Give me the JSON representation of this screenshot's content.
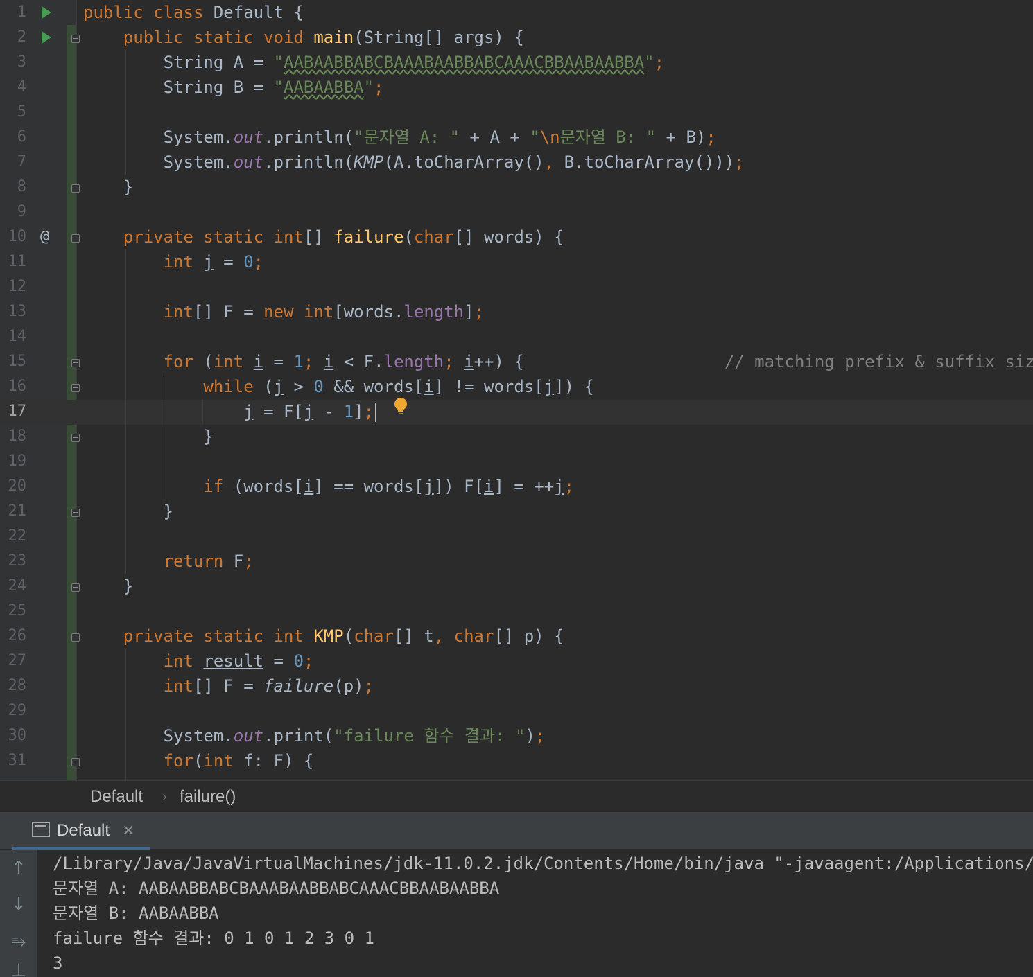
{
  "editor": {
    "current_line": 17,
    "lines": [
      {
        "n": "1",
        "tokens": [
          [
            "public class ",
            "kw"
          ],
          [
            "Default {",
            ""
          ]
        ]
      },
      {
        "n": "2",
        "tokens": [
          [
            "    public static void ",
            "kw"
          ],
          [
            "main",
            "fn"
          ],
          [
            "(String[] args) {",
            ""
          ]
        ]
      },
      {
        "n": "3",
        "tokens": [
          [
            "        String A = ",
            ""
          ],
          [
            "\"",
            "str"
          ],
          [
            "AABAABBABCBAAABAABBABCAAACBBAABAABBA",
            "str wavy"
          ],
          [
            "\"",
            "str"
          ],
          [
            ";",
            "kw"
          ]
        ]
      },
      {
        "n": "4",
        "tokens": [
          [
            "        String B = ",
            ""
          ],
          [
            "\"",
            "str"
          ],
          [
            "AABAABBA",
            "str wavy"
          ],
          [
            "\"",
            "str"
          ],
          [
            ";",
            "kw"
          ]
        ]
      },
      {
        "n": "5",
        "tokens": []
      },
      {
        "n": "6",
        "tokens": [
          [
            "        System.",
            ""
          ],
          [
            "out",
            "fld"
          ],
          [
            ".println(",
            ""
          ],
          [
            "\"문자열 A: \"",
            "str"
          ],
          [
            " + A + ",
            ""
          ],
          [
            "\"",
            "str"
          ],
          [
            "\\n",
            "kw"
          ],
          [
            "문자열 B: \"",
            "str"
          ],
          [
            " + B)",
            ""
          ],
          [
            ";",
            "kw"
          ]
        ]
      },
      {
        "n": "7",
        "tokens": [
          [
            "        System.",
            ""
          ],
          [
            "out",
            "fld"
          ],
          [
            ".println(",
            ""
          ],
          [
            "KMP",
            "ital"
          ],
          [
            "(A.toCharArray()",
            ""
          ],
          [
            ", ",
            "kw"
          ],
          [
            "B.toCharArray()))",
            ""
          ],
          [
            ";",
            "kw"
          ]
        ]
      },
      {
        "n": "8",
        "tokens": [
          [
            "    }",
            ""
          ]
        ]
      },
      {
        "n": "9",
        "tokens": []
      },
      {
        "n": "10",
        "tokens": [
          [
            "    private static int",
            "kw"
          ],
          [
            "[] ",
            ""
          ],
          [
            "failure",
            "fn"
          ],
          [
            "(",
            ""
          ],
          [
            "char",
            "kw"
          ],
          [
            "[] words) {",
            ""
          ]
        ]
      },
      {
        "n": "11",
        "tokens": [
          [
            "        int ",
            "kw"
          ],
          [
            "j",
            "ul"
          ],
          [
            " = ",
            ""
          ],
          [
            "0",
            "num"
          ],
          [
            ";",
            "kw"
          ]
        ]
      },
      {
        "n": "12",
        "tokens": []
      },
      {
        "n": "13",
        "tokens": [
          [
            "        int",
            "kw"
          ],
          [
            "[] F = ",
            ""
          ],
          [
            "new int",
            "kw"
          ],
          [
            "[words.",
            ""
          ],
          [
            "length",
            "prop"
          ],
          [
            "]",
            ""
          ],
          [
            ";",
            "kw"
          ]
        ]
      },
      {
        "n": "14",
        "tokens": []
      },
      {
        "n": "15",
        "tokens": [
          [
            "        for ",
            "kw"
          ],
          [
            "(",
            ""
          ],
          [
            "int ",
            "kw"
          ],
          [
            "i",
            "ul"
          ],
          [
            " = ",
            ""
          ],
          [
            "1",
            "num"
          ],
          [
            "; ",
            "kw"
          ],
          [
            "i",
            "ul"
          ],
          [
            " < F.",
            ""
          ],
          [
            "length",
            "prop"
          ],
          [
            "; ",
            "kw"
          ],
          [
            "i",
            "ul"
          ],
          [
            "++) {",
            ""
          ],
          [
            "                    // matching prefix & suffix size",
            "cmt"
          ]
        ]
      },
      {
        "n": "16",
        "tokens": [
          [
            "            while ",
            "kw"
          ],
          [
            "(",
            ""
          ],
          [
            "j",
            "ul"
          ],
          [
            " > ",
            ""
          ],
          [
            "0",
            "num"
          ],
          [
            " && words[",
            ""
          ],
          [
            "i",
            "ul"
          ],
          [
            "] != words[",
            ""
          ],
          [
            "j",
            "ul"
          ],
          [
            "]) {",
            ""
          ]
        ]
      },
      {
        "n": "17",
        "tokens": [
          [
            "                ",
            ""
          ],
          [
            "j",
            "ul"
          ],
          [
            " = F[",
            ""
          ],
          [
            "j",
            "ul"
          ],
          [
            " - ",
            ""
          ],
          [
            "1",
            "num"
          ],
          [
            "]",
            ""
          ],
          [
            ";",
            "kw"
          ]
        ],
        "cursor": true
      },
      {
        "n": "18",
        "tokens": [
          [
            "            }",
            ""
          ]
        ]
      },
      {
        "n": "19",
        "tokens": []
      },
      {
        "n": "20",
        "tokens": [
          [
            "            if ",
            "kw"
          ],
          [
            "(words[",
            ""
          ],
          [
            "i",
            "ul"
          ],
          [
            "] == words[",
            ""
          ],
          [
            "j",
            "ul"
          ],
          [
            "]) F[",
            ""
          ],
          [
            "i",
            "ul"
          ],
          [
            "] = ++",
            ""
          ],
          [
            "j",
            "ul"
          ],
          [
            ";",
            "kw"
          ]
        ]
      },
      {
        "n": "21",
        "tokens": [
          [
            "        }",
            ""
          ]
        ]
      },
      {
        "n": "22",
        "tokens": []
      },
      {
        "n": "23",
        "tokens": [
          [
            "        return ",
            "kw"
          ],
          [
            "F",
            ""
          ],
          [
            ";",
            "kw"
          ]
        ]
      },
      {
        "n": "24",
        "tokens": [
          [
            "    }",
            ""
          ]
        ]
      },
      {
        "n": "25",
        "tokens": []
      },
      {
        "n": "26",
        "tokens": [
          [
            "    private static int ",
            "kw"
          ],
          [
            "KMP",
            "fn"
          ],
          [
            "(",
            ""
          ],
          [
            "char",
            "kw"
          ],
          [
            "[] t",
            ""
          ],
          [
            ", ",
            "kw"
          ],
          [
            "char",
            "kw"
          ],
          [
            "[] p) {",
            ""
          ]
        ]
      },
      {
        "n": "27",
        "tokens": [
          [
            "        int ",
            "kw"
          ],
          [
            "result",
            "ul"
          ],
          [
            " = ",
            ""
          ],
          [
            "0",
            "num"
          ],
          [
            ";",
            "kw"
          ]
        ]
      },
      {
        "n": "28",
        "tokens": [
          [
            "        int",
            "kw"
          ],
          [
            "[] F = ",
            ""
          ],
          [
            "failure",
            "ital"
          ],
          [
            "(p)",
            ""
          ],
          [
            ";",
            "kw"
          ]
        ]
      },
      {
        "n": "29",
        "tokens": []
      },
      {
        "n": "30",
        "tokens": [
          [
            "        System.",
            ""
          ],
          [
            "out",
            "fld"
          ],
          [
            ".print(",
            ""
          ],
          [
            "\"failure 함수 결과: \"",
            "str"
          ],
          [
            ")",
            ""
          ],
          [
            ";",
            "kw"
          ]
        ]
      },
      {
        "n": "31",
        "tokens": [
          [
            "        for",
            "kw"
          ],
          [
            "(",
            ""
          ],
          [
            "int ",
            "kw"
          ],
          [
            "f: F) {",
            ""
          ]
        ]
      }
    ]
  },
  "gutter_icons": {
    "run_lines": [
      1,
      2
    ],
    "override_line": 10,
    "override_symbol": "@",
    "fold_lines": [
      2,
      8,
      10,
      15,
      16,
      18,
      21,
      24,
      26,
      31
    ]
  },
  "breadcrumb": {
    "class_name": "Default",
    "method_name": "failure()"
  },
  "run_panel": {
    "tab_label": "Default",
    "close_symbol": "✕",
    "output": [
      "/Library/Java/JavaVirtualMachines/jdk-11.0.2.jdk/Contents/Home/bin/java \"-javaagent:/Applications/Int",
      "문자열 A: AABAABBABCBAAABAABBABCAAACBBAABAABBA",
      "문자열 B: AABAABBA",
      "failure 함수 결과: 0 1 0 1 2 3 0 1",
      "3"
    ]
  },
  "colors": {
    "background": "#2b2b2b",
    "keyword": "#cc7832",
    "function": "#ffc66d",
    "string": "#6a8759",
    "number": "#6897bb",
    "field": "#9876aa",
    "comment": "#808080",
    "text": "#a9b7c6"
  }
}
